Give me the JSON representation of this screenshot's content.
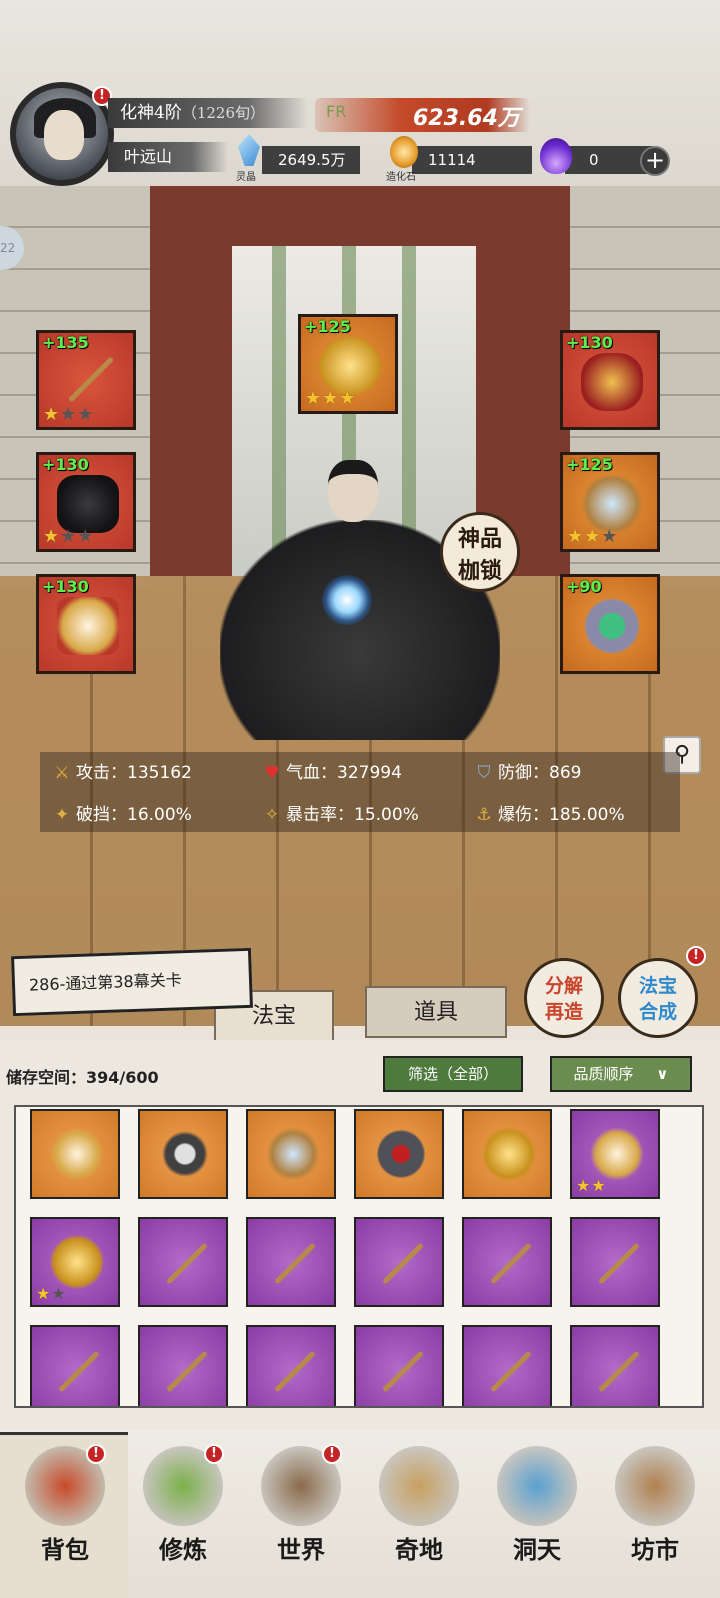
{
  "player": {
    "realm": "化神4阶",
    "age": "（1226旬）",
    "name": "叶远山",
    "fr_text": "FR",
    "combat_power": "623.64万"
  },
  "resources": [
    {
      "icon": "spirit-crystal-icon",
      "label": "灵晶",
      "value": "2649.5万"
    },
    {
      "icon": "creation-stone-icon",
      "label": "造化石",
      "value": "11114"
    },
    {
      "icon": "purple-flame-icon",
      "value": "0"
    }
  ],
  "left_edge_badge": "22",
  "equipment": [
    {
      "level": "+135",
      "stars": 1,
      "color": "red",
      "icon": "staff-icon"
    },
    {
      "level": "+125",
      "stars": 3,
      "color": "orange",
      "icon": "golden-cloud-icon"
    },
    {
      "level": "+130",
      "stars": 0,
      "color": "red",
      "icon": "crown-icon"
    },
    {
      "level": "+130",
      "stars": 1,
      "color": "red",
      "icon": "robe-icon"
    },
    {
      "level": "+125",
      "stars": 2,
      "color": "orange",
      "icon": "amulet-icon"
    },
    {
      "level": "+130",
      "stars": 0,
      "color": "red",
      "icon": "boots-icon"
    },
    {
      "level": "+90",
      "stars": 0,
      "color": "orange",
      "icon": "ring-icon"
    }
  ],
  "shackle_badge": {
    "line1": "神品",
    "line2": "枷锁"
  },
  "stats": {
    "attack_label": "攻击：",
    "attack": "135162",
    "hp_label": "气血：",
    "hp": "327994",
    "defense_label": "防御：",
    "defense": "869",
    "break_label": "破挡：",
    "break": "16.00%",
    "crit_label": "暴击率：",
    "crit": "15.00%",
    "crit_dmg_label": "爆伤：",
    "crit_dmg": "185.00%"
  },
  "quest": "286-通过第38幕关卡",
  "tabs": {
    "treasure": "法宝",
    "items": "道具"
  },
  "action_buttons": {
    "decompose": {
      "line1": "分解",
      "line2": "再造"
    },
    "combine": {
      "line1": "法宝",
      "line2": "合成"
    }
  },
  "storage": {
    "label": "储存空间：",
    "value": "394/600"
  },
  "filter_label": "筛选（全部）",
  "sort_label": "品质顺序",
  "sort_arrow": "∨",
  "inventory": [
    {
      "color": "orange",
      "icon": "boots-icon",
      "stars": 0
    },
    {
      "color": "orange",
      "icon": "pendant-icon",
      "stars": 0
    },
    {
      "color": "orange",
      "icon": "amulet-icon",
      "stars": 0
    },
    {
      "color": "orange",
      "icon": "ring-icon",
      "stars": 0
    },
    {
      "color": "orange",
      "icon": "golden-cloud-icon",
      "stars": 0
    },
    {
      "color": "purple",
      "icon": "boots-icon",
      "stars": 2
    },
    {
      "color": "purple",
      "icon": "golden-cloud-icon",
      "stars": 1
    },
    {
      "color": "purple",
      "icon": "staff-icon",
      "stars": 0
    },
    {
      "color": "purple",
      "icon": "staff-icon",
      "stars": 0
    },
    {
      "color": "purple",
      "icon": "staff-icon",
      "stars": 0
    },
    {
      "color": "purple",
      "icon": "staff-icon",
      "stars": 0
    },
    {
      "color": "purple",
      "icon": "staff-icon",
      "stars": 0
    },
    {
      "color": "purple",
      "icon": "staff-icon",
      "stars": 0
    },
    {
      "color": "purple",
      "icon": "staff-icon",
      "stars": 0
    },
    {
      "color": "purple",
      "icon": "staff-icon",
      "stars": 0
    },
    {
      "color": "purple",
      "icon": "staff-icon",
      "stars": 0
    },
    {
      "color": "purple",
      "icon": "staff-icon",
      "stars": 0
    },
    {
      "color": "purple",
      "icon": "staff-icon",
      "stars": 0
    }
  ],
  "nav": [
    {
      "label": "背包",
      "icon": "backpack-icon",
      "alert": true
    },
    {
      "label": "修炼",
      "icon": "lotus-icon",
      "alert": true
    },
    {
      "label": "世界",
      "icon": "scroll-map-icon",
      "alert": true
    },
    {
      "label": "奇地",
      "icon": "floating-island-icon",
      "alert": false
    },
    {
      "label": "洞天",
      "icon": "portal-icon",
      "alert": false
    },
    {
      "label": "坊市",
      "icon": "market-stall-icon",
      "alert": false
    }
  ],
  "colors": {
    "combat_power_bg": "#c44a2a",
    "slot_red": "#c8422e",
    "slot_orange": "#d9802c",
    "rarity_purple": "#9a4cb4",
    "level_text_green": "#5cf04c",
    "button_green": "#4e7a3e"
  }
}
